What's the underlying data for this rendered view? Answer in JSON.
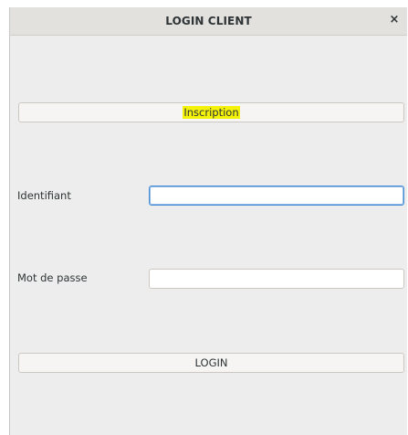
{
  "window": {
    "title": "LOGIN CLIENT",
    "close_glyph": "×"
  },
  "buttons": {
    "inscription_label": "Inscription",
    "login_label": "LOGIN"
  },
  "form": {
    "identifiant_label": "Identifiant",
    "identifiant_value": "",
    "password_label": "Mot de passe",
    "password_value": ""
  },
  "colors": {
    "highlight": "#f5f20a",
    "focus_border": "#4a90d9"
  },
  "icons": {
    "close": "close-icon"
  }
}
